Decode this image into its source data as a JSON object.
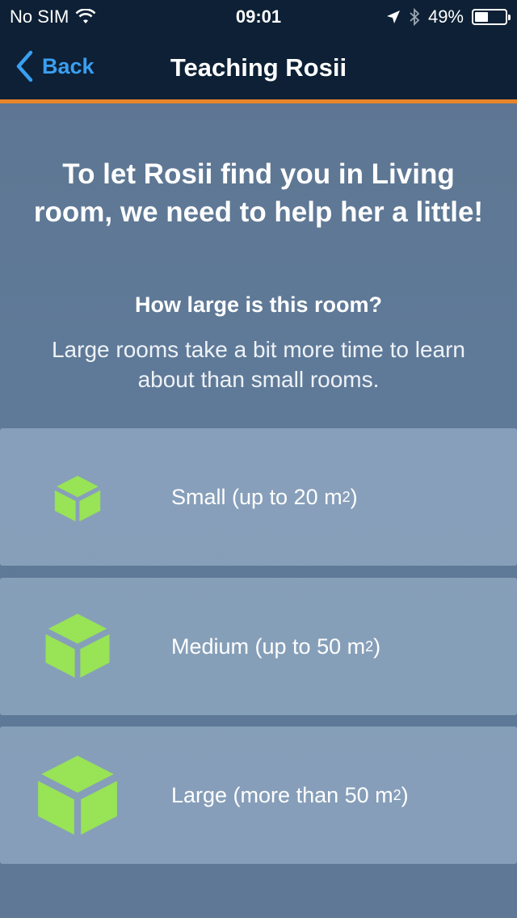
{
  "status_bar": {
    "carrier": "No SIM",
    "time": "09:01",
    "battery_percent": "49%",
    "battery_level": 0.49,
    "icons": [
      "wifi-icon",
      "location-arrow-icon",
      "bluetooth-icon",
      "battery-icon"
    ]
  },
  "nav": {
    "back_label": "Back",
    "title": "Teaching Rosii",
    "accent_color": "#e8852a",
    "link_color": "#3a9ff0"
  },
  "content": {
    "headline": "To let Rosii find you in Living room, we need to help her a little!",
    "question": "How large is this room?",
    "description": "Large rooms take a bit more time to learn about than small rooms."
  },
  "options": [
    {
      "label_prefix": "Small (up to 20 m",
      "superscript": "2",
      "label_suffix": ")",
      "icon": "small-cube-icon"
    },
    {
      "label_prefix": "Medium (up to 50 m",
      "superscript": "2",
      "label_suffix": ")",
      "icon": "medium-cube-icon"
    },
    {
      "label_prefix": "Large (more than 50 m",
      "superscript": "2",
      "label_suffix": ")",
      "icon": "large-cube-icon"
    }
  ],
  "colors": {
    "cube": "#98e356",
    "nav_background": "#0d2035"
  }
}
